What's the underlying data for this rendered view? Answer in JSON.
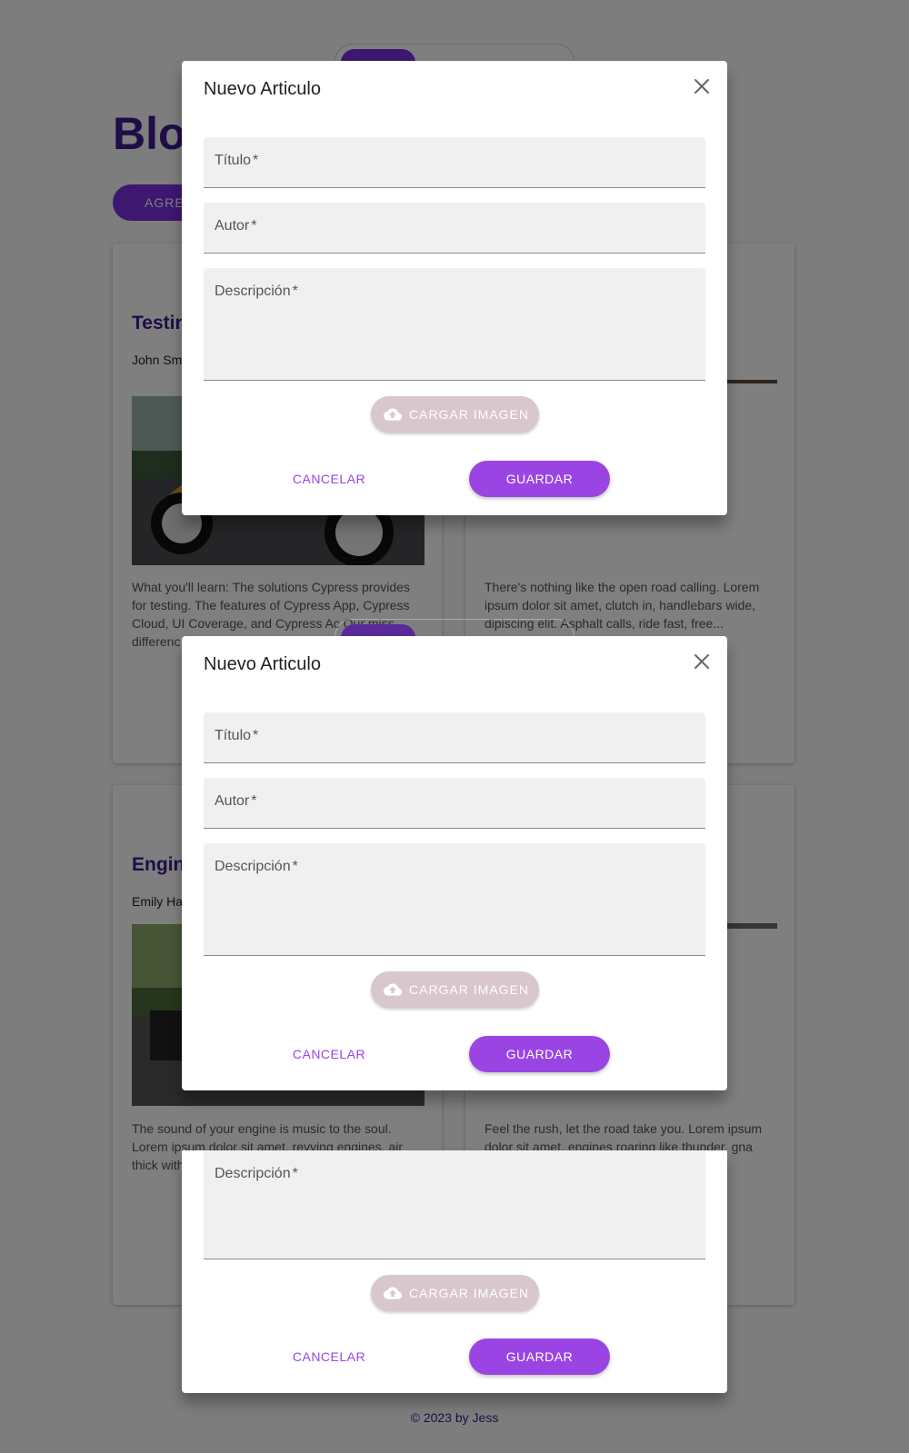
{
  "background": {
    "page_title": "Blo",
    "add_button_label": "AGREGAR",
    "cards": [
      {
        "title": "Testin",
        "author": "John Sm",
        "excerpt": "What you'll learn: The solutions Cypress provides for testing. The features of Cypress App, Cypress Cloud, UI Coverage, and Cypress Ac Our miss differenc"
      },
      {
        "excerpt": "There's nothing like the open road calling. Lorem ipsum dolor sit amet, clutch in, handlebars wide, dipiscing elit. Asphalt calls, ride fast, free..."
      },
      {
        "title": "Engin",
        "author": "Emily Ha",
        "excerpt": "The sound of your engine is music to the soul. Lorem ipsum dolor sit amet, revving engines, air thick with Harley d labore..."
      },
      {
        "excerpt": "Feel the rush, let the road take you. Lorem ipsum dolor sit amet, engines roaring like thunder, gna labore"
      }
    ],
    "footer": "© 2023 by Jess"
  },
  "dialog": {
    "title": "Nuevo Articulo",
    "fields": {
      "titulo": "Título",
      "autor": "Autor",
      "descripcion": "Descripción",
      "required_mark": "*"
    },
    "upload_label": "CARGAR IMAGEN",
    "cancel_label": "CANCELAR",
    "save_label": "GUARDAR",
    "icons": {
      "close": "close-icon",
      "upload": "cloud-upload-icon"
    }
  },
  "colors": {
    "accent": "#9a45e3",
    "brand_dark": "#3d1a8c",
    "upload_disabled": "#d9c7ce",
    "field_bg": "#f0f0f0",
    "scrim": "rgba(0,0,0,0.5)"
  }
}
